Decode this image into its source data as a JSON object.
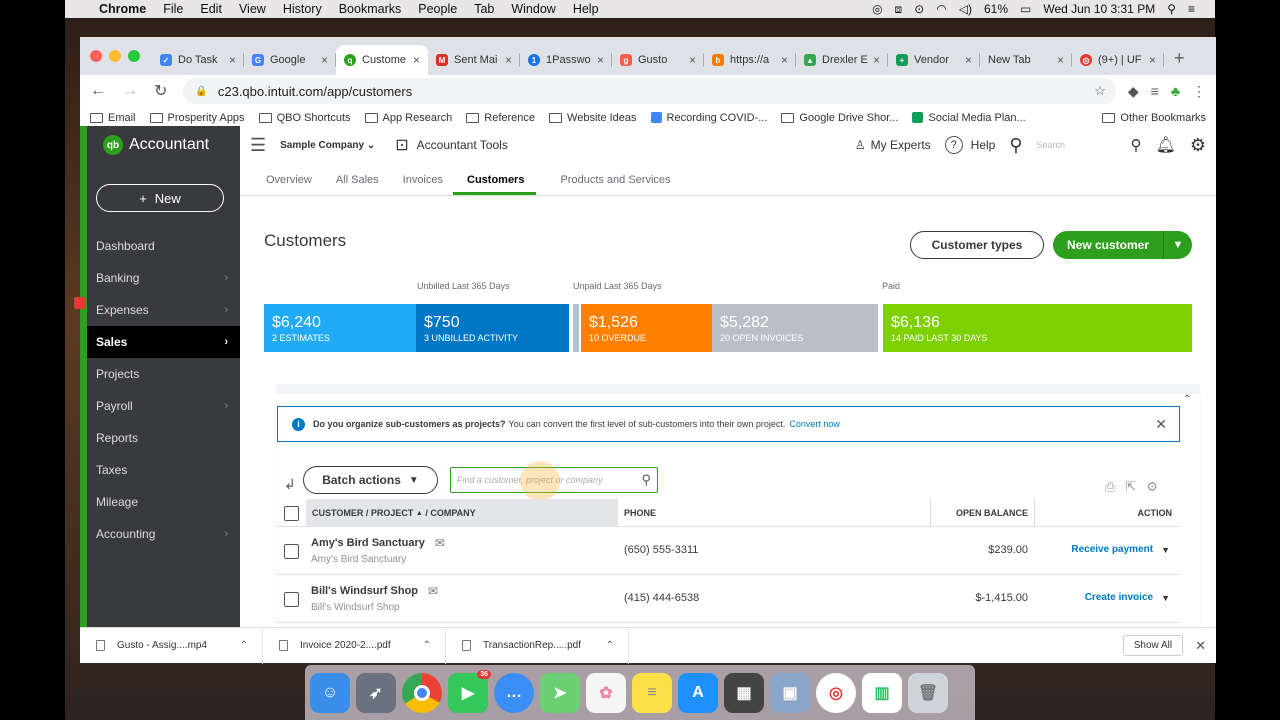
{
  "menubar": {
    "app": "Chrome",
    "items": [
      "File",
      "Edit",
      "View",
      "History",
      "Bookmarks",
      "People",
      "Tab",
      "Window",
      "Help"
    ],
    "battery": "61%",
    "clock": "Wed Jun 10  3:31 PM"
  },
  "tabs": [
    {
      "label": "Do Task",
      "color": "#4285f4",
      "icon": "task-icon"
    },
    {
      "label": "Google",
      "color": "#4285f4",
      "icon": "google-icon"
    },
    {
      "label": "Custome",
      "color": "#2ca01c",
      "icon": "qbo-icon"
    },
    {
      "label": "Sent Mai",
      "color": "#d93025",
      "icon": "gmail-icon"
    },
    {
      "label": "1Passwo",
      "color": "#1a73e8",
      "icon": "1password-icon"
    },
    {
      "label": "Gusto",
      "color": "#f45d48",
      "icon": "gusto-icon"
    },
    {
      "label": "https://a",
      "color": "#f57c00",
      "icon": "b-icon"
    },
    {
      "label": "Drexler E",
      "color": "#34a853",
      "icon": "drive-icon"
    },
    {
      "label": "Vendor",
      "color": "#0f9d58",
      "icon": "sheets-icon"
    },
    {
      "label": "New Tab",
      "color": "",
      "icon": ""
    },
    {
      "label": "(9+) | UF",
      "color": "#e53935",
      "icon": "app-icon"
    }
  ],
  "address": {
    "url": "c23.qbo.intuit.com/app/customers"
  },
  "bookmarks": [
    {
      "label": "Email",
      "type": "folder"
    },
    {
      "label": "Prosperity Apps",
      "type": "folder"
    },
    {
      "label": "QBO Shortcuts",
      "type": "folder"
    },
    {
      "label": "App Research",
      "type": "folder"
    },
    {
      "label": "Reference",
      "type": "folder"
    },
    {
      "label": "Website Ideas",
      "type": "folder"
    },
    {
      "label": "Recording COVID-...",
      "type": "doc"
    },
    {
      "label": "Google Drive Shor...",
      "type": "folder"
    },
    {
      "label": "Social Media Plan...",
      "type": "sheet"
    }
  ],
  "bookmarks_other": "Other Bookmarks",
  "sidebar": {
    "brand": "Accountant",
    "new_label": "New",
    "items": [
      {
        "label": "Dashboard",
        "chevron": false
      },
      {
        "label": "Banking",
        "chevron": true
      },
      {
        "label": "Expenses",
        "chevron": true
      },
      {
        "label": "Sales",
        "chevron": true,
        "active": true
      },
      {
        "label": "Projects",
        "chevron": false
      },
      {
        "label": "Payroll",
        "chevron": true
      },
      {
        "label": "Reports",
        "chevron": false
      },
      {
        "label": "Taxes",
        "chevron": false
      },
      {
        "label": "Mileage",
        "chevron": false
      },
      {
        "label": "Accounting",
        "chevron": true
      }
    ]
  },
  "topbar": {
    "company": "Sample Company",
    "tools": "Accountant Tools",
    "experts": "My Experts",
    "help": "Help",
    "search_placeholder": "Search"
  },
  "subnav": [
    "Overview",
    "All Sales",
    "Invoices",
    "Customers",
    "Products and Services"
  ],
  "page": {
    "title": "Customers",
    "types_button": "Customer types",
    "new_button": "New customer"
  },
  "money_bar": {
    "captions": {
      "unbilled": "Unbilled Last 365 Days",
      "unpaid": "Unpaid Last 365 Days",
      "paid": "Paid"
    },
    "segments": [
      {
        "amount": "$6,240",
        "sub": "2 ESTIMATES",
        "color": "#21abf6"
      },
      {
        "amount": "$750",
        "sub": "3 UNBILLED ACTIVITY",
        "color": "#0077c5"
      },
      {
        "amount": "$1,526",
        "sub": "10 OVERDUE",
        "color": "#ff8000"
      },
      {
        "amount": "$5,282",
        "sub": "20 OPEN INVOICES",
        "color": "#babec5"
      },
      {
        "amount": "$6,136",
        "sub": "14 PAID LAST 30 DAYS",
        "color": "#7fd000"
      }
    ]
  },
  "info": {
    "bold": "Do you organize sub-customers as projects?",
    "text": "You can convert the first level of sub-customers into their own project.",
    "link": "Convert now"
  },
  "table": {
    "batch": "Batch actions",
    "search_placeholder": "Find a customer, project or company",
    "headers": {
      "customer": "CUSTOMER / PROJECT",
      "company": "/  COMPANY",
      "phone": "PHONE",
      "balance": "OPEN BALANCE",
      "action": "ACTION"
    },
    "rows": [
      {
        "name": "Amy's Bird Sanctuary",
        "company": "Amy's Bird Sanctuary",
        "phone": "(650) 555-3311",
        "balance": "$239.00",
        "action": "Receive payment"
      },
      {
        "name": "Bill's Windsurf Shop",
        "company": "Bill's Windsurf Shop",
        "phone": "(415) 444-6538",
        "balance": "$-1,415.00",
        "action": "Create invoice"
      }
    ]
  },
  "downloads": [
    {
      "label": "Gusto - Assig....mp4"
    },
    {
      "label": "Invoice 2020-2....pdf"
    },
    {
      "label": "TransactionRep.....pdf"
    }
  ],
  "downloads_showall": "Show All",
  "dock": [
    {
      "name": "finder",
      "color": "#3b8ee8",
      "icon": "finder-icon"
    },
    {
      "name": "launchpad",
      "color": "#6b7280",
      "icon": "rocket-icon"
    },
    {
      "name": "chrome",
      "color": "#e8e8e8",
      "icon": "chrome-icon"
    },
    {
      "name": "facetime",
      "color": "#34c759",
      "icon": "facetime-icon",
      "badge": "36"
    },
    {
      "name": "messages",
      "color": "#3a8ef6",
      "icon": "messages-icon"
    },
    {
      "name": "maps",
      "color": "#6ccf73",
      "icon": "maps-icon"
    },
    {
      "name": "photos",
      "color": "#f5f5f5",
      "icon": "photos-icon"
    },
    {
      "name": "notes",
      "color": "#fde047",
      "icon": "notes-icon"
    },
    {
      "name": "appstore",
      "color": "#1e90ff",
      "icon": "appstore-icon"
    },
    {
      "name": "calculator",
      "color": "#444",
      "icon": "calculator-icon"
    },
    {
      "name": "preview",
      "color": "#8aa6c8",
      "icon": "preview-icon"
    },
    {
      "name": "app",
      "color": "#e53935",
      "icon": "spiral-icon"
    },
    {
      "name": "numbers",
      "color": "#22c55e",
      "icon": "chart-icon"
    },
    {
      "name": "trash",
      "color": "#cfd4da",
      "icon": "trash-icon"
    }
  ]
}
